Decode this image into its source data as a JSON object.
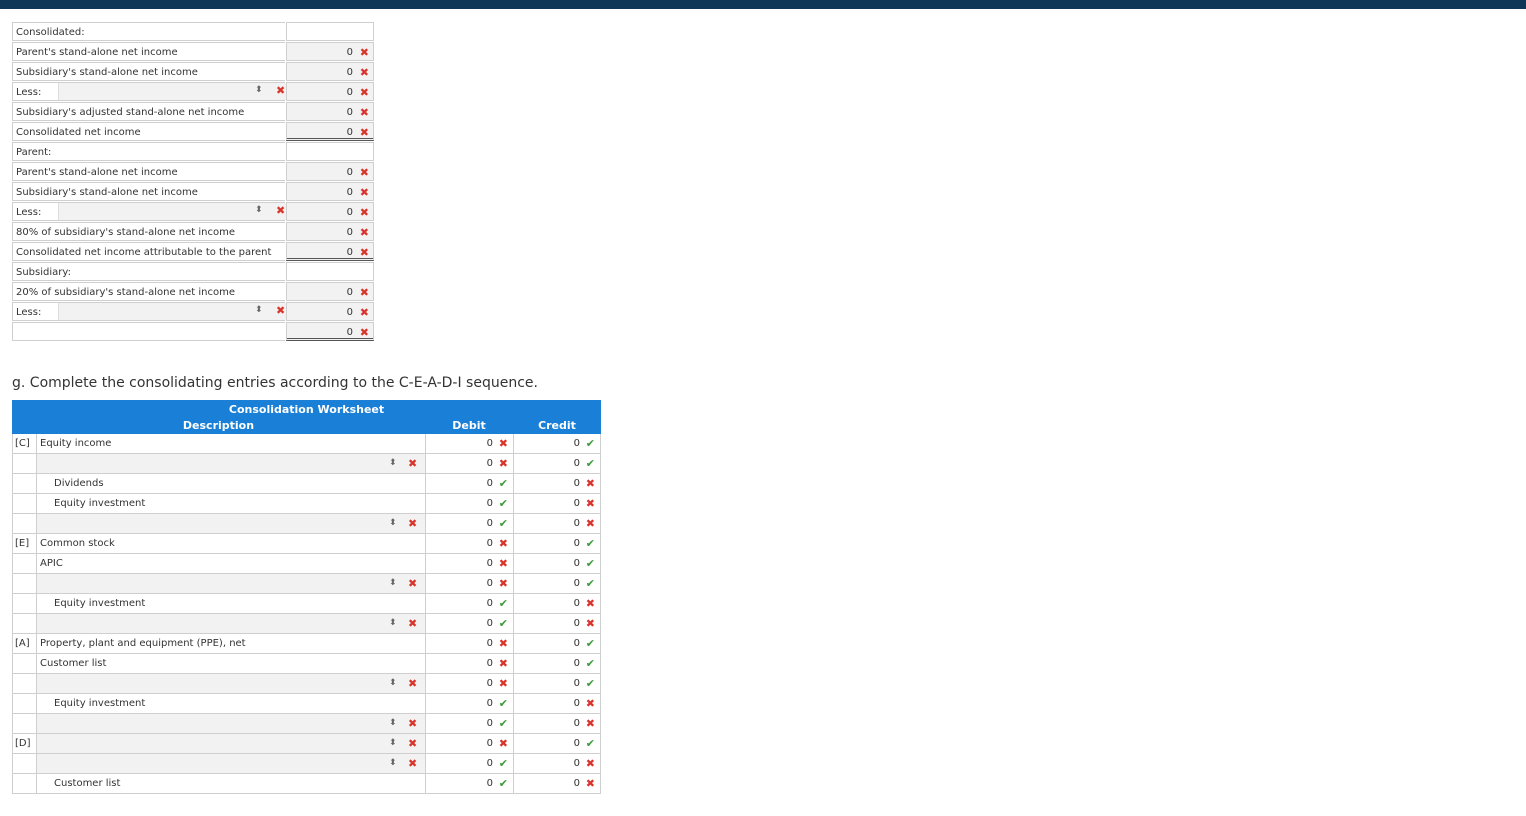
{
  "upper": {
    "rows": [
      {
        "label": "Consolidated:",
        "kind": "header"
      },
      {
        "label": "Parent's stand-alone net income",
        "value": "0",
        "mark": "x"
      },
      {
        "label": "Subsidiary's stand-alone net income",
        "value": "0",
        "mark": "x"
      },
      {
        "label": "Less:",
        "kind": "select",
        "value": "0",
        "mark": "x"
      },
      {
        "label": "Subsidiary's adjusted stand-alone net income",
        "value": "0",
        "mark": "x"
      },
      {
        "label": "Consolidated net income",
        "value": "0",
        "mark": "x",
        "total": true
      },
      {
        "label": "Parent:",
        "kind": "header"
      },
      {
        "label": "Parent's stand-alone net income",
        "value": "0",
        "mark": "x"
      },
      {
        "label": "Subsidiary's stand-alone net income",
        "value": "0",
        "mark": "x"
      },
      {
        "label": "Less:",
        "kind": "select",
        "value": "0",
        "mark": "x"
      },
      {
        "label": "80% of subsidiary's stand-alone net income",
        "value": "0",
        "mark": "x"
      },
      {
        "label": "Consolidated net income attributable to the parent",
        "value": "0",
        "mark": "x",
        "total": true
      },
      {
        "label": "Subsidiary:",
        "kind": "header"
      },
      {
        "label": "20% of subsidiary's stand-alone net income",
        "value": "0",
        "mark": "x"
      },
      {
        "label": "Less:",
        "kind": "select",
        "value": "0",
        "mark": "x"
      },
      {
        "label": "",
        "kind": "blank",
        "value": "0",
        "mark": "x",
        "total": true
      }
    ]
  },
  "instruction": "g. Complete the consolidating entries according to the C-E-A-D-I sequence.",
  "worksheet": {
    "title": "Consolidation Worksheet",
    "col_desc": "Description",
    "col_debit": "Debit",
    "col_credit": "Credit",
    "rows": [
      {
        "tag": "[C]",
        "desc": "Equity income",
        "indent": false,
        "sel": false,
        "debit": "0",
        "dmark": "x",
        "credit": "0",
        "cmark": "ok"
      },
      {
        "tag": "",
        "desc": "",
        "indent": false,
        "sel": true,
        "debit": "0",
        "dmark": "x",
        "credit": "0",
        "cmark": "ok"
      },
      {
        "tag": "",
        "desc": "Dividends",
        "indent": true,
        "sel": false,
        "debit": "0",
        "dmark": "ok",
        "credit": "0",
        "cmark": "x"
      },
      {
        "tag": "",
        "desc": "Equity investment",
        "indent": true,
        "sel": false,
        "debit": "0",
        "dmark": "ok",
        "credit": "0",
        "cmark": "x"
      },
      {
        "tag": "",
        "desc": "",
        "indent": false,
        "sel": true,
        "debit": "0",
        "dmark": "ok",
        "credit": "0",
        "cmark": "x"
      },
      {
        "tag": "[E]",
        "desc": "Common stock",
        "indent": false,
        "sel": false,
        "debit": "0",
        "dmark": "x",
        "credit": "0",
        "cmark": "ok"
      },
      {
        "tag": "",
        "desc": "APIC",
        "indent": false,
        "sel": false,
        "debit": "0",
        "dmark": "x",
        "credit": "0",
        "cmark": "ok"
      },
      {
        "tag": "",
        "desc": "",
        "indent": false,
        "sel": true,
        "debit": "0",
        "dmark": "x",
        "credit": "0",
        "cmark": "ok"
      },
      {
        "tag": "",
        "desc": "Equity investment",
        "indent": true,
        "sel": false,
        "debit": "0",
        "dmark": "ok",
        "credit": "0",
        "cmark": "x"
      },
      {
        "tag": "",
        "desc": "",
        "indent": false,
        "sel": true,
        "debit": "0",
        "dmark": "ok",
        "credit": "0",
        "cmark": "x"
      },
      {
        "tag": "[A]",
        "desc": "Property, plant and equipment (PPE), net",
        "indent": false,
        "sel": false,
        "debit": "0",
        "dmark": "x",
        "credit": "0",
        "cmark": "ok"
      },
      {
        "tag": "",
        "desc": "Customer list",
        "indent": false,
        "sel": false,
        "debit": "0",
        "dmark": "x",
        "credit": "0",
        "cmark": "ok"
      },
      {
        "tag": "",
        "desc": "",
        "indent": false,
        "sel": true,
        "debit": "0",
        "dmark": "x",
        "credit": "0",
        "cmark": "ok"
      },
      {
        "tag": "",
        "desc": "Equity investment",
        "indent": true,
        "sel": false,
        "debit": "0",
        "dmark": "ok",
        "credit": "0",
        "cmark": "x"
      },
      {
        "tag": "",
        "desc": "",
        "indent": false,
        "sel": true,
        "debit": "0",
        "dmark": "ok",
        "credit": "0",
        "cmark": "x"
      },
      {
        "tag": "[D]",
        "desc": "",
        "indent": false,
        "sel": true,
        "debit": "0",
        "dmark": "x",
        "credit": "0",
        "cmark": "ok"
      },
      {
        "tag": "",
        "desc": "",
        "indent": false,
        "sel": true,
        "debit": "0",
        "dmark": "ok",
        "credit": "0",
        "cmark": "x"
      },
      {
        "tag": "",
        "desc": "Customer list",
        "indent": true,
        "sel": false,
        "debit": "0",
        "dmark": "ok",
        "credit": "0",
        "cmark": "x"
      }
    ]
  },
  "icons": {
    "wrong": "x-mark-icon",
    "correct": "check-mark-icon",
    "dropdown": "updown-arrows-icon"
  },
  "colors": {
    "header_bar": "#1a7fd6",
    "wrong": "#d9342b",
    "correct": "#3a9a3a"
  }
}
